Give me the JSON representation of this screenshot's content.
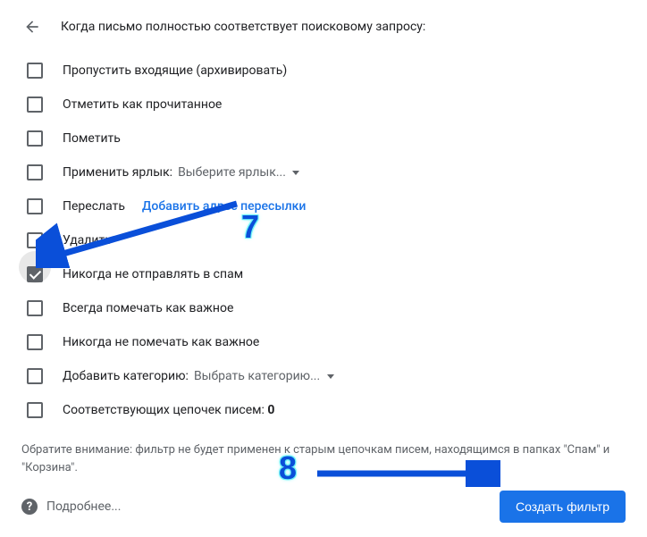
{
  "header": {
    "title": "Когда письмо полностью соответствует поисковому запросу:"
  },
  "options": {
    "skip_inbox": {
      "label": "Пропустить входящие (архивировать)",
      "checked": false
    },
    "mark_read": {
      "label": "Отметить как прочитанное",
      "checked": false
    },
    "star": {
      "label": "Пометить",
      "checked": false
    },
    "apply_label": {
      "label": "Применить ярлык:",
      "dropdown": "Выберите ярлык...",
      "checked": false
    },
    "forward": {
      "label": "Переслать",
      "link": "Добавить адрес пересылки",
      "checked": false
    },
    "delete": {
      "label": "Удалить",
      "checked": false
    },
    "never_spam": {
      "label": "Никогда не отправлять в спам",
      "checked": true
    },
    "always_important": {
      "label": "Всегда помечать как важное",
      "checked": false
    },
    "never_important": {
      "label": "Никогда не помечать как важное",
      "checked": false
    },
    "categorize": {
      "label": "Добавить категорию:",
      "dropdown": "Выбрать категорию...",
      "checked": false
    },
    "matching": {
      "label_prefix": "Соответствующих цепочек писем: ",
      "count": "0",
      "checked": false
    }
  },
  "note": "Обратите внимание: фильтр не будет применен к старым цепочкам писем, находящимся в папках \"Спам\" и \"Корзина\".",
  "footer": {
    "learn_more": "Подробнее...",
    "create": "Создать фильтр"
  },
  "annotations": {
    "num7": "7",
    "num8": "8"
  }
}
